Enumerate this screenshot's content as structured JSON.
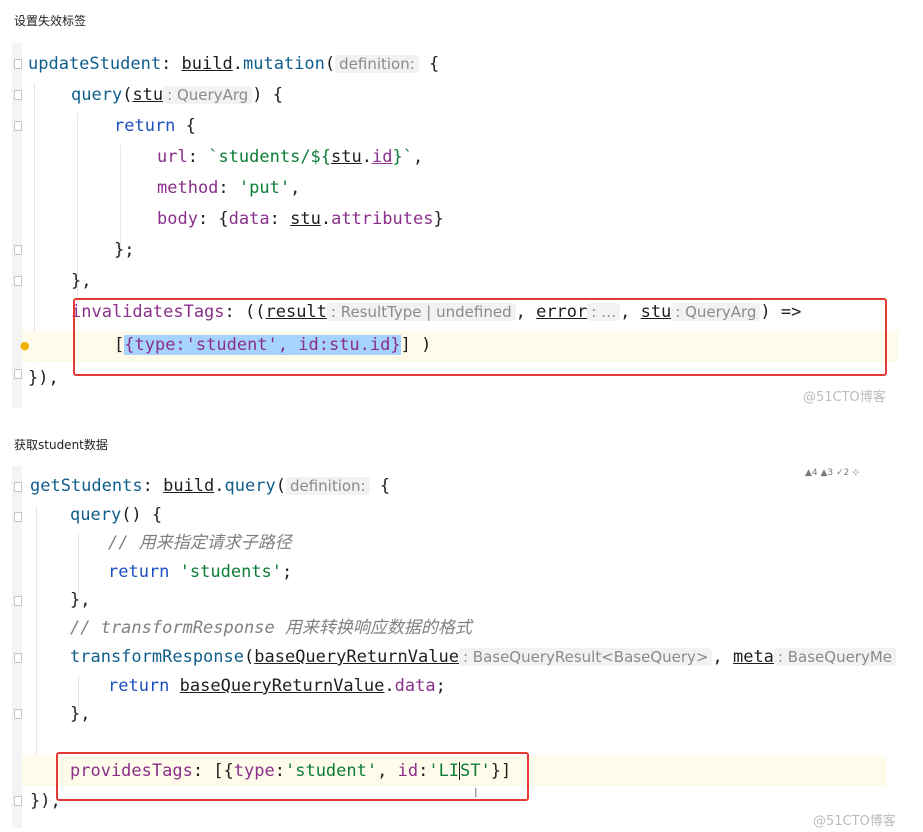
{
  "section1": {
    "heading": "设置失效标签",
    "watermark": "@51CTO博客",
    "lines": {
      "l1": {
        "name": "updateStudent",
        "p1": ": ",
        "obj": "build",
        "dot": ".",
        "method": "mutation",
        "paren": "(",
        "hint": "definition:",
        "brace": " {"
      },
      "l2": {
        "fn": "query",
        "paren": "(",
        "param": "stu",
        "hint": ": QueryArg",
        "rest": ") {"
      },
      "l3": {
        "kw": "return",
        "rest": " {"
      },
      "l4": {
        "prop": "url",
        "colon": ": ",
        "tpl1": "`students/${",
        "var": "stu",
        "dot": ".",
        "id": "id",
        "tpl2": "}`",
        "rest": ","
      },
      "l5": {
        "prop": "method",
        "colon": ": ",
        "str": "'put'",
        "rest": ","
      },
      "l6": {
        "prop": "body",
        "colon": ": {",
        "prop2": "data",
        "colon2": ": ",
        "var": "stu",
        "dot": ".",
        "attr": "attributes",
        "rest": "}"
      },
      "l7": {
        "text": "};"
      },
      "l8": {
        "text": "},"
      },
      "l9": {
        "prop": "invalidatesTags",
        "colon": ": ((",
        "p1": "result",
        "h1": ": ResultType | undefined",
        "c1": ", ",
        "p2": "error",
        "h2": ": …",
        "c2": ", ",
        "p3": "stu",
        "h3": ": QueryArg",
        "rest": ") =>"
      },
      "l10": {
        "open": "[",
        "sel": "{type:'student', id:stu.id}",
        "close": "] )"
      },
      "l11": {
        "text": "}),"
      }
    }
  },
  "section2": {
    "heading": "获取student数据",
    "watermark": "@51CTO博客",
    "inspections": "▲4  ▲3  ✓2  ⊹",
    "lines": {
      "l1": {
        "name": "getStudents",
        "p1": ": ",
        "obj": "build",
        "dot": ".",
        "method": "query",
        "paren": "(",
        "hint": "definition:",
        "brace": " {"
      },
      "l2": {
        "fn": "query",
        "rest": "() {"
      },
      "l3": {
        "comment": "// 用来指定请求子路径"
      },
      "l4": {
        "kw": "return",
        "sp": " ",
        "str": "'students'",
        "rest": ";"
      },
      "l5": {
        "text": "},"
      },
      "l6": {
        "comment": "// transformResponse 用来转换响应数据的格式"
      },
      "l7": {
        "fn": "transformResponse",
        "paren": "(",
        "p1": "baseQueryReturnValue",
        "h1": ": BaseQueryResult<BaseQuery>",
        "c1": ", ",
        "p2": "meta",
        "h2": ": BaseQueryMe"
      },
      "l8": {
        "kw": "return",
        "sp": " ",
        "var": "baseQueryReturnValue",
        "dot": ".",
        "prop": "data",
        "rest": ";"
      },
      "l9": {
        "text": "},"
      },
      "l10": {
        "prop": "providesTags",
        "colon": ": [{",
        "k1": "type",
        "c1": ":",
        "s1": "'student'",
        "c2": ", ",
        "k2": "id",
        "c3": ":",
        "s2a": "'LI",
        "s2b": "ST'",
        "rest": "}]"
      },
      "l11": {
        "text": "}),"
      }
    }
  }
}
